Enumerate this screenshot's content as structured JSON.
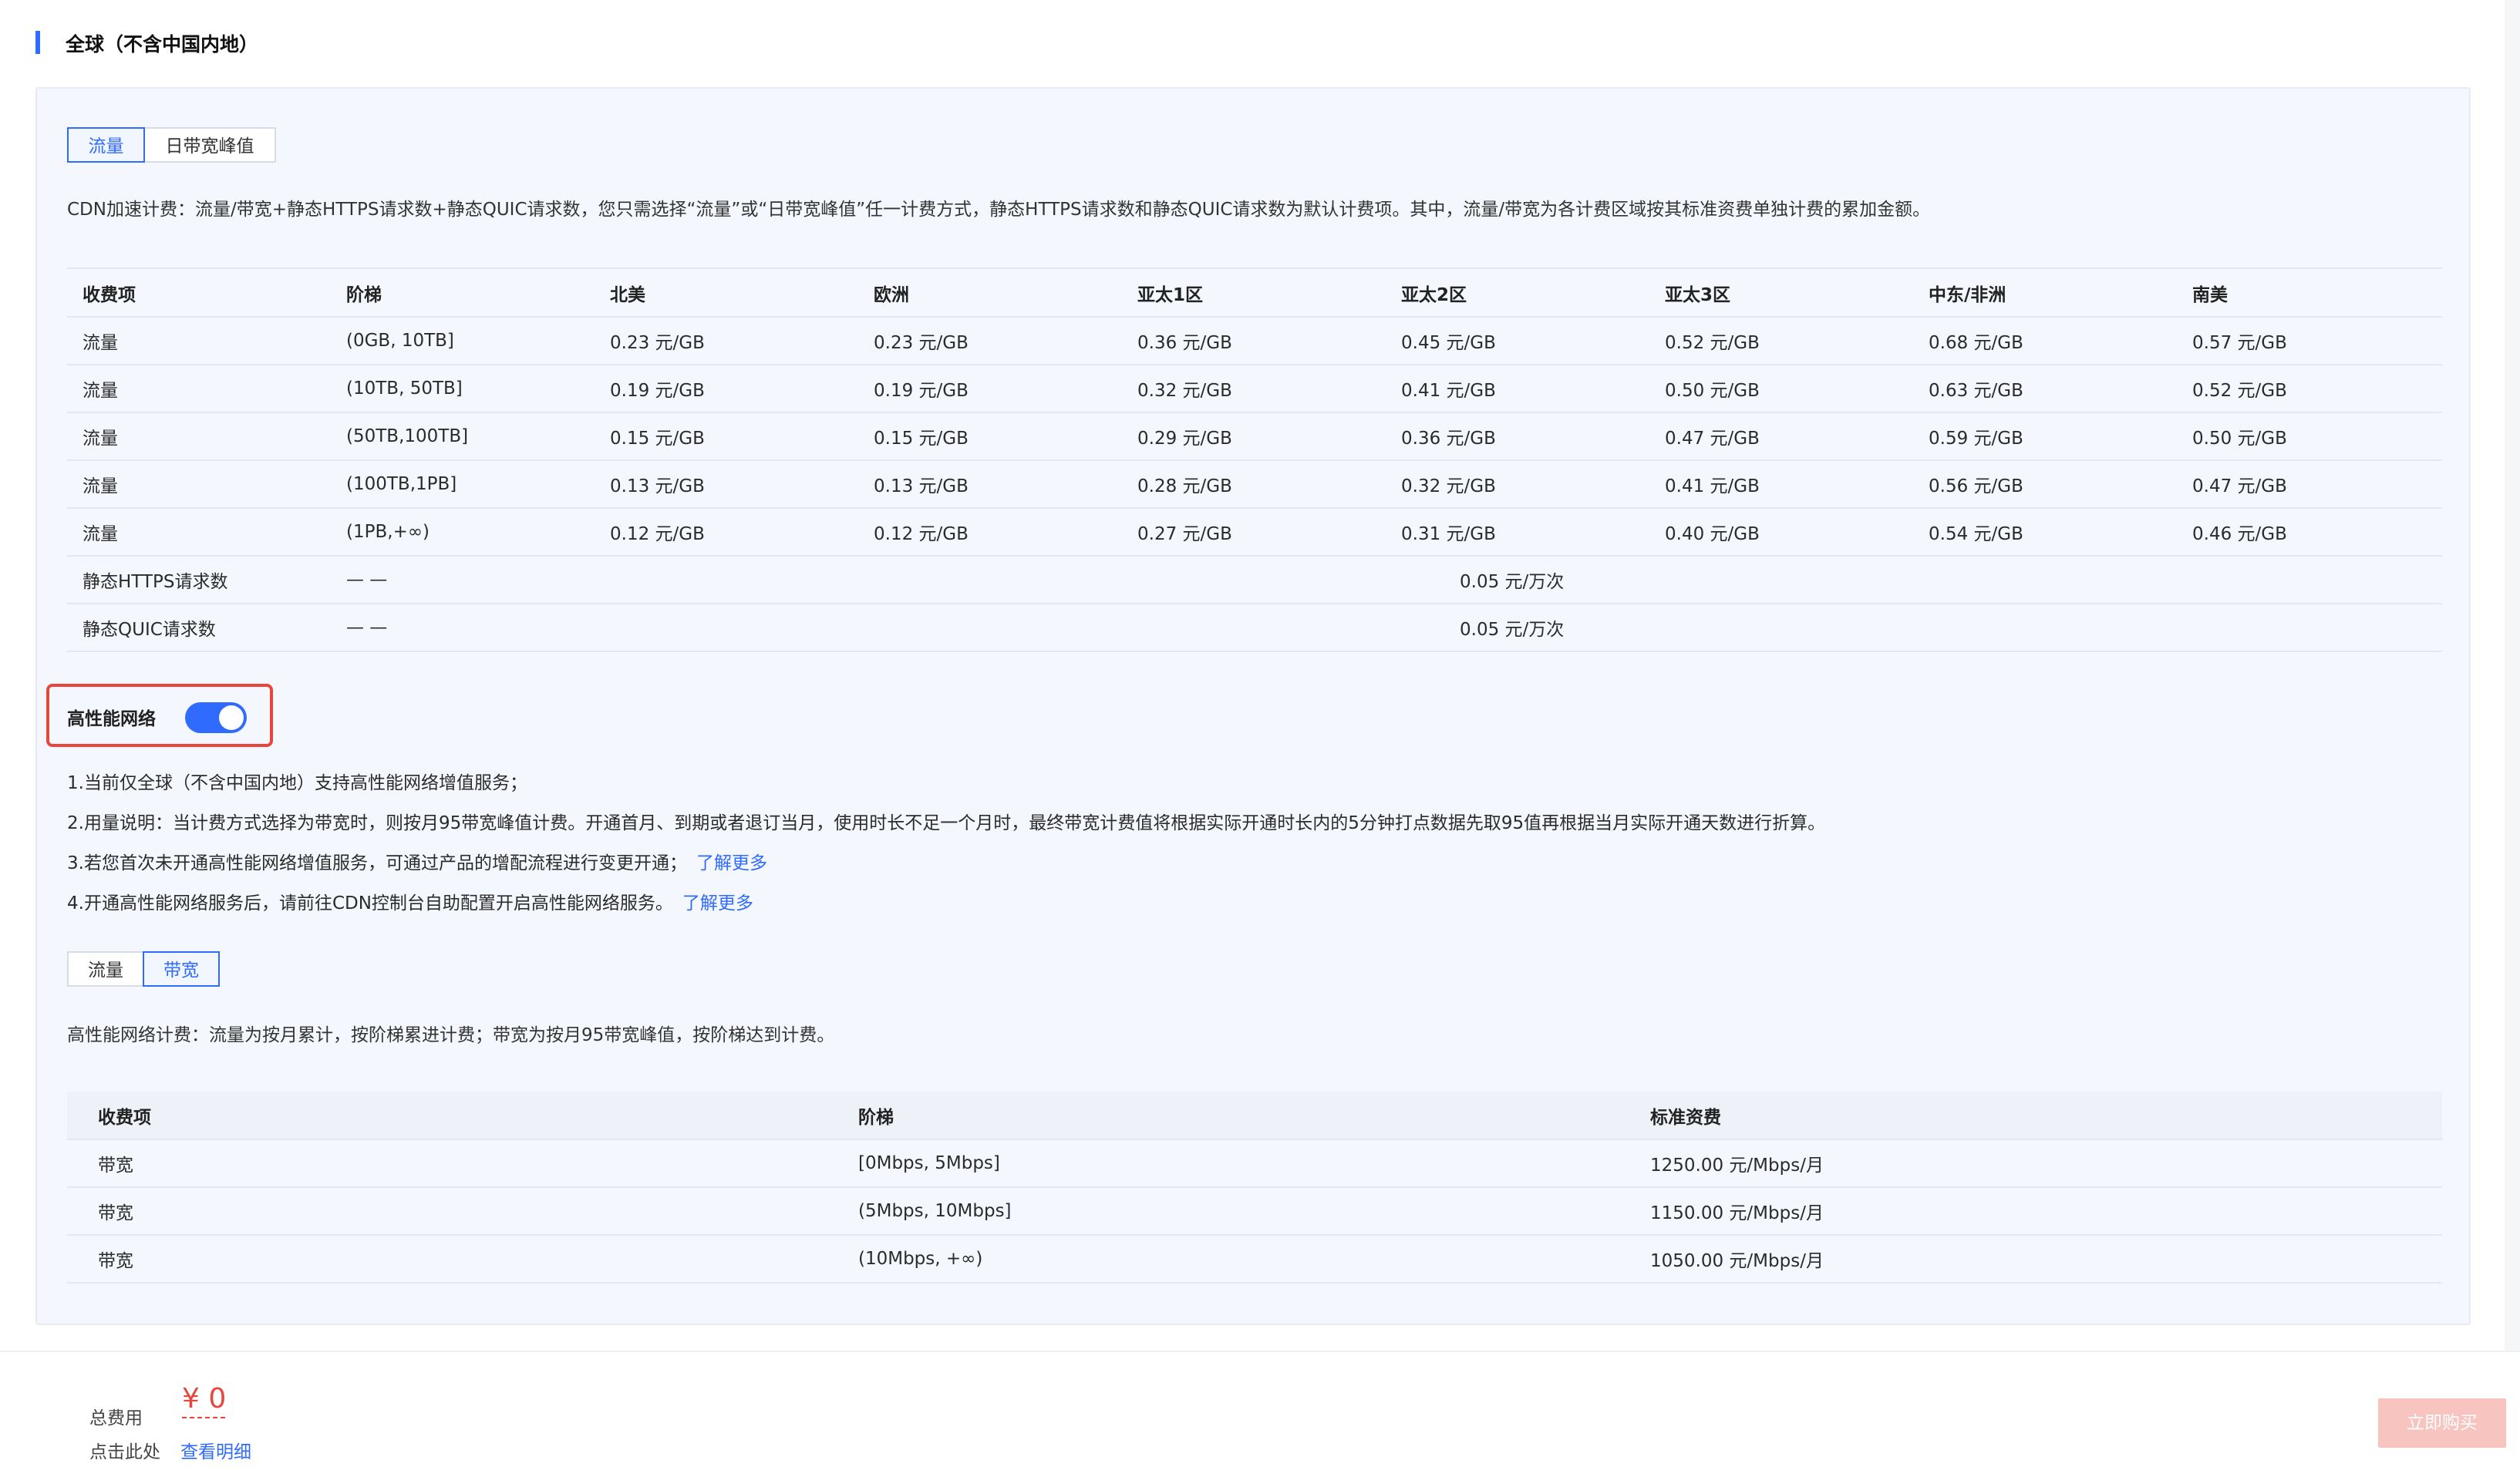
{
  "section_title": "全球（不含中国内地）",
  "tabs1": [
    {
      "label": "流量",
      "active": true
    },
    {
      "label": "日带宽峰值",
      "active": false
    }
  ],
  "cdn_desc": "CDN加速计费：流量/带宽+静态HTTPS请求数+静态QUIC请求数，您只需选择“流量”或“日带宽峰值”任一计费方式，静态HTTPS请求数和静态QUIC请求数为默认计费项。其中，流量/带宽为各计费区域按其标准资费单独计费的累加金额。",
  "traffic_table": {
    "headers": [
      "收费项",
      "阶梯",
      "北美",
      "欧洲",
      "亚太1区",
      "亚太2区",
      "亚太3区",
      "中东/非洲",
      "南美"
    ],
    "rows": [
      [
        "流量",
        "(0GB, 10TB]",
        "0.23 元/GB",
        "0.23 元/GB",
        "0.36 元/GB",
        "0.45 元/GB",
        "0.52 元/GB",
        "0.68 元/GB",
        "0.57 元/GB"
      ],
      [
        "流量",
        "(10TB, 50TB]",
        "0.19 元/GB",
        "0.19 元/GB",
        "0.32 元/GB",
        "0.41 元/GB",
        "0.50 元/GB",
        "0.63 元/GB",
        "0.52 元/GB"
      ],
      [
        "流量",
        "(50TB,100TB]",
        "0.15 元/GB",
        "0.15 元/GB",
        "0.29 元/GB",
        "0.36 元/GB",
        "0.47 元/GB",
        "0.59 元/GB",
        "0.50 元/GB"
      ],
      [
        "流量",
        "(100TB,1PB]",
        "0.13 元/GB",
        "0.13 元/GB",
        "0.28 元/GB",
        "0.32 元/GB",
        "0.41 元/GB",
        "0.56 元/GB",
        "0.47 元/GB"
      ],
      [
        "流量",
        "(1PB,+∞)",
        "0.12 元/GB",
        "0.12 元/GB",
        "0.27 元/GB",
        "0.31 元/GB",
        "0.40 元/GB",
        "0.54 元/GB",
        "0.46 元/GB"
      ]
    ],
    "https": {
      "item": "静态HTTPS请求数",
      "tier": "— —",
      "price": "0.05 元/万次"
    },
    "quic": {
      "item": "静态QUIC请求数",
      "tier": "— —",
      "price": "0.05 元/万次"
    }
  },
  "high_perf": {
    "label": "高性能网络",
    "enabled": true
  },
  "notes": [
    {
      "text": "1.当前仅全球（不含中国内地）支持高性能网络增值服务；",
      "link": ""
    },
    {
      "text": "2.用量说明：当计费方式选择为带宽时，则按月95带宽峰值计费。开通首月、到期或者退订当月，使用时长不足一个月时，最终带宽计费值将根据实际开通时长内的5分钟打点数据先取95值再根据当月实际开通天数进行折算。",
      "link": ""
    },
    {
      "text": "3.若您首次未开通高性能网络增值服务，可通过产品的增配流程进行变更开通；",
      "link": "了解更多"
    },
    {
      "text": "4.开通高性能网络服务后，请前往CDN控制台自助配置开启高性能网络服务。",
      "link": "了解更多"
    }
  ],
  "tabs2": [
    {
      "label": "流量",
      "active": false
    },
    {
      "label": "带宽",
      "active": true
    }
  ],
  "hp_desc": "高性能网络计费：流量为按月累计，按阶梯累进计费；带宽为按月95带宽峰值，按阶梯达到计费。",
  "bandwidth_table": {
    "headers": [
      "收费项",
      "阶梯",
      "标准资费"
    ],
    "rows": [
      [
        "带宽",
        "[0Mbps, 5Mbps]",
        "1250.00 元/Mbps/月"
      ],
      [
        "带宽",
        "(5Mbps, 10Mbps]",
        "1150.00 元/Mbps/月"
      ],
      [
        "带宽",
        "(10Mbps, +∞)",
        "1050.00 元/Mbps/月"
      ]
    ]
  },
  "footer": {
    "total_label": "总费用",
    "price": "¥ 0",
    "click_label": "点击此处",
    "detail_link": "查看明细",
    "buy_button": "立即购买"
  }
}
